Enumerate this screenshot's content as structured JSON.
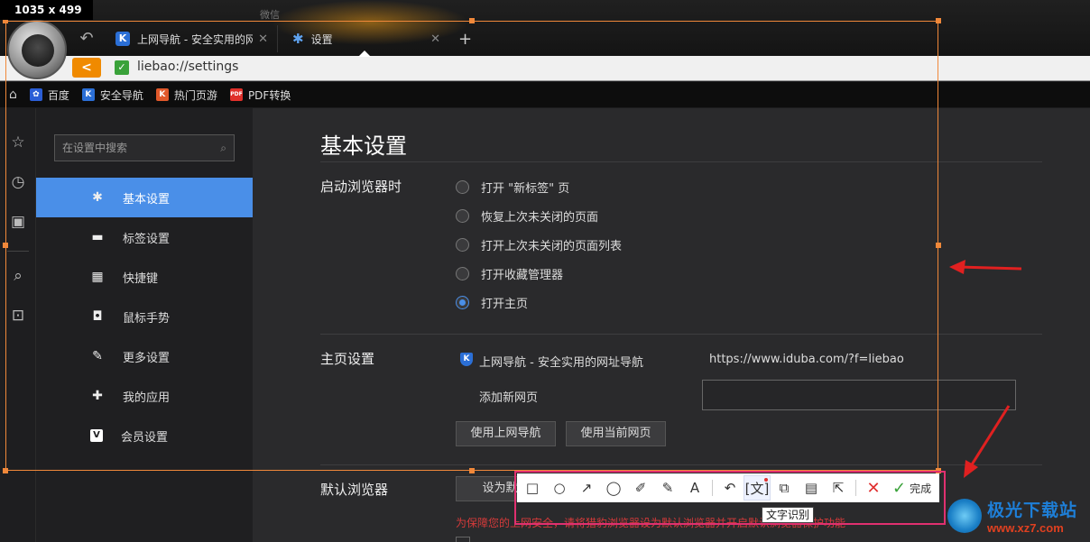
{
  "capture": {
    "size_label": "1035 x 499"
  },
  "titlebar": {
    "wechat_label": "微信"
  },
  "tabs": [
    {
      "label": "上网导航 - 安全实用的网",
      "icon": "K"
    },
    {
      "label": "设置"
    }
  ],
  "address": {
    "url": "liebao://settings"
  },
  "bookmarks": [
    {
      "label": "百度",
      "icon": "baidu-icon",
      "color": "#2b5ed6"
    },
    {
      "label": "安全导航",
      "icon": "K",
      "color": "#2b6fd6"
    },
    {
      "label": "热门页游",
      "icon": "K",
      "color": "#e0582a"
    },
    {
      "label": "PDF转换",
      "icon": "PDF",
      "color": "#e0302a"
    }
  ],
  "sidebar": {
    "search_placeholder": "在设置中搜索",
    "items": [
      {
        "label": "基本设置",
        "icon": "gear-icon"
      },
      {
        "label": "标签设置",
        "icon": "tab-icon"
      },
      {
        "label": "快捷键",
        "icon": "keyboard-icon"
      },
      {
        "label": "鼠标手势",
        "icon": "mouse-icon"
      },
      {
        "label": "更多设置",
        "icon": "wrench-icon"
      },
      {
        "label": "我的应用",
        "icon": "puzzle-icon"
      },
      {
        "label": "会员设置",
        "icon": "vip-icon"
      }
    ]
  },
  "main": {
    "title": "基本设置",
    "startup": {
      "label": "启动浏览器时",
      "options": [
        "打开 \"新标签\" 页",
        "恢复上次未关闭的页面",
        "打开上次未关闭的页面列表",
        "打开收藏管理器",
        "打开主页"
      ],
      "selected_index": 4
    },
    "homepage": {
      "label": "主页设置",
      "current_name": "上网导航 - 安全实用的网址导航",
      "current_url": "https://www.iduba.com/?f=liebao",
      "add_label": "添加新网页",
      "btn_use_nav": "使用上网导航",
      "btn_use_current": "使用当前网页"
    },
    "default_browser": {
      "label": "默认浏览器",
      "btn_set_default": "设为默认",
      "warning": "为保障您的上网安全，请将猎豹浏览器设为默认浏览器并开启默认浏览器保护功能"
    }
  },
  "toolbar": {
    "done_label": "完成",
    "tooltip": "文字识别",
    "tools": [
      "rectangle-icon",
      "ellipse-icon",
      "arrow-icon",
      "speech-bubble-icon",
      "brush-icon",
      "pencil-icon",
      "text-icon",
      "undo-icon",
      "ocr-icon",
      "translate-icon",
      "save-icon",
      "share-icon",
      "close-icon"
    ]
  },
  "watermark": {
    "name": "极光下载站",
    "url": "www.xz7.com"
  },
  "colors": {
    "accent": "#4a8fe8",
    "capture_border": "#f0883a",
    "toolbar_frame": "#e03070",
    "warning": "#d43a3a"
  }
}
